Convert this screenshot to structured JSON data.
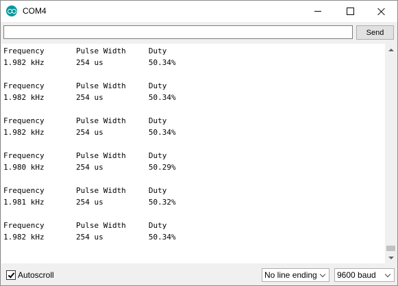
{
  "window": {
    "title": "COM4",
    "icon": "arduino-logo-icon"
  },
  "send": {
    "input_value": "",
    "button_label": "Send"
  },
  "serial_output": [
    "Frequency       Pulse Width     Duty",
    "1.982 kHz       254 us          50.34%",
    "",
    "Frequency       Pulse Width     Duty",
    "1.982 kHz       254 us          50.34%",
    "",
    "Frequency       Pulse Width     Duty",
    "1.982 kHz       254 us          50.34%",
    "",
    "Frequency       Pulse Width     Duty",
    "1.980 kHz       254 us          50.29%",
    "",
    "Frequency       Pulse Width     Duty",
    "1.981 kHz       254 us          50.32%",
    "",
    "Frequency       Pulse Width     Duty",
    "1.982 kHz       254 us          50.34%"
  ],
  "footer": {
    "autoscroll_label": "Autoscroll",
    "autoscroll_checked": true,
    "line_ending": "No line ending",
    "baud_rate": "9600 baud"
  },
  "colors": {
    "arduino_teal": "#00979c"
  }
}
